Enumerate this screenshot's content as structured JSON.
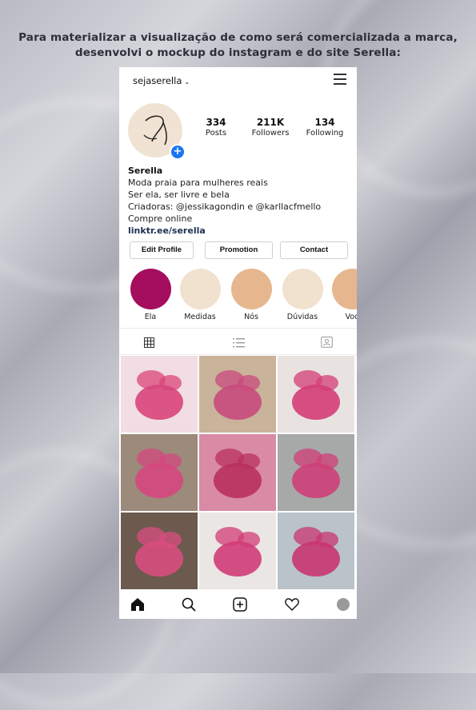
{
  "caption": {
    "line1": "Para materializar a visualização de como será comercializada a marca,",
    "line2": "desenvolvi o mockup do instagram e do site Serella:"
  },
  "profile": {
    "username": "sejaserella",
    "stats": [
      {
        "value": "334",
        "label": "Posts"
      },
      {
        "value": "211K",
        "label": "Followers"
      },
      {
        "value": "134",
        "label": "Following"
      }
    ],
    "bio": {
      "name": "Serella",
      "lines": [
        "Moda praia para mulheres reais",
        "Ser ela, ser livre e bela",
        "Criadoras: @jessikagondin e @karllacfmello",
        "Compre online"
      ],
      "link": "linktr.ee/serella"
    },
    "buttons": [
      "Edit Profile",
      "Promotion",
      "Contact"
    ]
  },
  "highlights": [
    {
      "label": "Ela",
      "color": "#a50d5f"
    },
    {
      "label": "Medidas",
      "color": "#f1e1cf"
    },
    {
      "label": "Nós",
      "color": "#e6b78e"
    },
    {
      "label": "Dúvidas",
      "color": "#f1e1cf"
    },
    {
      "label": "Voc",
      "color": "#e6b78e"
    }
  ],
  "tabs": [
    "grid-icon",
    "list-icon",
    "tagged-icon"
  ],
  "posts": [
    {
      "bg": "#f1dde3",
      "fg": "#d9457a"
    },
    {
      "bg": "#c9b39a",
      "fg": "#c84a7d"
    },
    {
      "bg": "#e8e3e1",
      "fg": "#d43d77"
    },
    {
      "bg": "#9c8a7a",
      "fg": "#d6477f"
    },
    {
      "bg": "#d98aa5",
      "fg": "#b8305f"
    },
    {
      "bg": "#a7a9a8",
      "fg": "#cf3f78"
    },
    {
      "bg": "#6c5a4e",
      "fg": "#d94d80"
    },
    {
      "bg": "#eae6e4",
      "fg": "#d23c77"
    },
    {
      "bg": "#b9c3c9",
      "fg": "#c93670"
    }
  ],
  "bottom_nav": [
    "home-icon",
    "search-icon",
    "new-post-icon",
    "activity-icon",
    "profile-icon"
  ]
}
